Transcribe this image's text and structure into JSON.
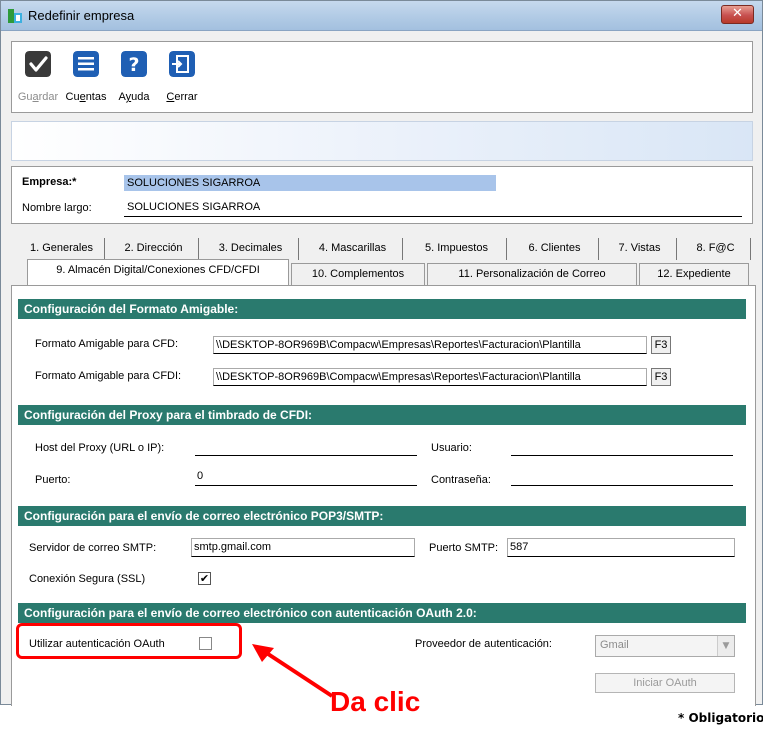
{
  "window": {
    "title": "Redefinir empresa",
    "close_glyph": "✕"
  },
  "toolbar": [
    {
      "id": "guardar",
      "label": "Guardar",
      "icon": "checkmark-icon",
      "enabled": false
    },
    {
      "id": "cuentas",
      "label": "Cuentas",
      "icon": "list-icon",
      "enabled": true
    },
    {
      "id": "ayuda",
      "label": "Ayuda",
      "icon": "help-icon",
      "enabled": true
    },
    {
      "id": "cerrar",
      "label": "Cerrar",
      "icon": "exit-door-icon",
      "enabled": true
    }
  ],
  "company": {
    "empresa_label": "Empresa:*",
    "empresa_value": "SOLUCIONES SIGARROA",
    "nombre_label": "Nombre largo:",
    "nombre_value": "SOLUCIONES SIGARROA"
  },
  "tabs_row1": [
    "1. Generales",
    "2. Dirección",
    "3. Decimales",
    "4. Mascarillas",
    "5. Impuestos",
    "6. Clientes",
    "7. Vistas",
    "8. F@C"
  ],
  "tabs_row2": [
    "9. Almacén Digital/Conexiones CFD/CFDI",
    "10. Complementos",
    "11. Personalización de Correo",
    "12. Expediente"
  ],
  "active_tab": "9. Almacén Digital/Conexiones CFD/CFDI",
  "formato": {
    "header": "Configuración del Formato Amigable:",
    "cfd_label": "Formato Amigable para CFD:",
    "cfd_value": "\\\\DESKTOP-8OR969B\\Compacw\\Empresas\\Reportes\\Facturacion\\Plantilla",
    "cfdi_label": "Formato Amigable para CFDI:",
    "cfdi_value": "\\\\DESKTOP-8OR969B\\Compacw\\Empresas\\Reportes\\Facturacion\\Plantilla",
    "f3_label": "F3"
  },
  "proxy": {
    "header": "Configuración del Proxy para el timbrado de CFDI:",
    "host_label": "Host del Proxy (URL o IP):",
    "host_value": "",
    "usuario_label": "Usuario:",
    "usuario_value": "",
    "puerto_label": "Puerto:",
    "puerto_value": "0",
    "contrasena_label": "Contraseña:",
    "contrasena_value": ""
  },
  "smtp": {
    "header": "Configuración para el envío de correo electrónico POP3/SMTP:",
    "servidor_label": "Servidor de correo SMTP:",
    "servidor_value": "smtp.gmail.com",
    "puerto_label": "Puerto SMTP:",
    "puerto_value": "587",
    "ssl_label": "Conexión Segura (SSL)",
    "ssl_checked": true,
    "check_glyph": "✔"
  },
  "oauth": {
    "header": "Configuración para el envío de correo electrónico con autenticación OAuth 2.0:",
    "utilizar_label": "Utilizar autenticación OAuth",
    "utilizar_checked": false,
    "proveedor_label": "Proveedor de autenticación:",
    "proveedor_value": "Gmail",
    "iniciar_label": "Iniciar OAuth"
  },
  "annotation": {
    "text": "Da clic",
    "color": "#ff0000"
  },
  "footer": {
    "obligatorio": "* Obligatorio"
  },
  "colors": {
    "section_header": "#2a7a6e",
    "selection": "#a8c4ea",
    "annotation": "#ff0000"
  }
}
